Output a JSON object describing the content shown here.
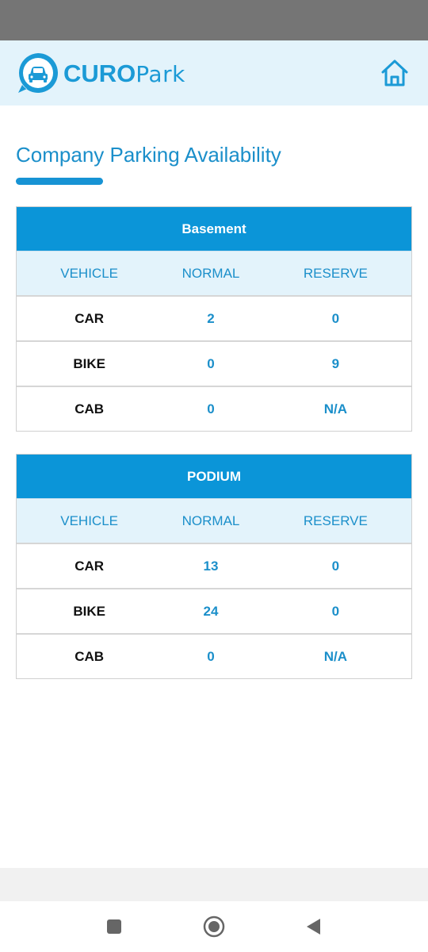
{
  "app": {
    "logo_bold": "CURO",
    "logo_light": "Park",
    "brand_color": "#1b9ad6",
    "header_bg": "#e3f3fb"
  },
  "page": {
    "title": "Company Parking Availability"
  },
  "tables": [
    {
      "caption": "Basement",
      "headers": [
        "VEHICLE",
        "NORMAL",
        "RESERVE"
      ],
      "rows": [
        [
          "CAR",
          "2",
          "0"
        ],
        [
          "BIKE",
          "0",
          "9"
        ],
        [
          "CAB",
          "0",
          "N/A"
        ]
      ]
    },
    {
      "caption": "PODIUM",
      "headers": [
        "VEHICLE",
        "NORMAL",
        "RESERVE"
      ],
      "rows": [
        [
          "CAR",
          "13",
          "0"
        ],
        [
          "BIKE",
          "24",
          "0"
        ],
        [
          "CAB",
          "0",
          "N/A"
        ]
      ]
    }
  ],
  "icons": {
    "home": "home-icon",
    "nav_recents": "square-icon",
    "nav_home": "circle-icon",
    "nav_back": "back-triangle-icon"
  }
}
